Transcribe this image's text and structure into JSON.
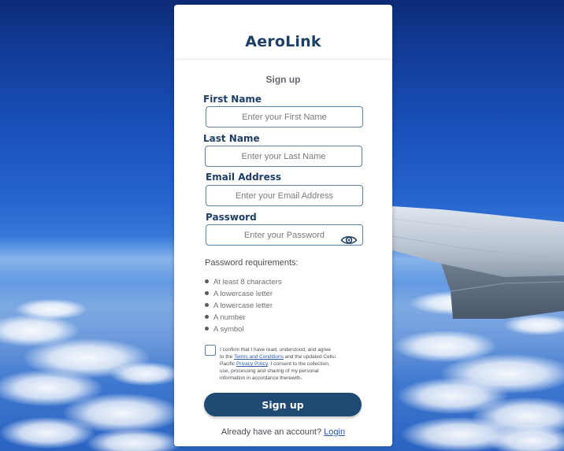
{
  "app": {
    "brand": "AeroLink"
  },
  "form": {
    "title": "Sign up",
    "first_name": {
      "label": "First Name",
      "placeholder": "Enter your First Name"
    },
    "last_name": {
      "label": "Last Name",
      "placeholder": "Enter your Last Name"
    },
    "email": {
      "label": "Email Address",
      "placeholder": "Enter your Email Address"
    },
    "password": {
      "label": "Password",
      "placeholder": "Enter your Password",
      "toggle_icon": "eye-icon"
    },
    "requirements": {
      "title": "Password requirements:",
      "items": [
        "At least 8 characters",
        "A lowercase letter",
        "A lowercase letter",
        "A number",
        "A symbol"
      ]
    },
    "consent": {
      "text_1": "I confirm that I have read, understood, and agree to the ",
      "terms_link": "Terms and Conditions",
      "text_2": " and the updated Cebu Pacific ",
      "privacy_link": "Privacy Policy",
      "text_3": ". I consent to the collection, use, processing and sharing of my personal information in accordance therewith."
    },
    "submit_label": "Sign up",
    "login_prompt": "Already have an account?",
    "login_link": "Login"
  },
  "colors": {
    "brand": "#1e3f66",
    "button": "#1f4a74",
    "link": "#2a5db0",
    "input_border": "#5b80a8",
    "sky": "#1a52bd"
  }
}
